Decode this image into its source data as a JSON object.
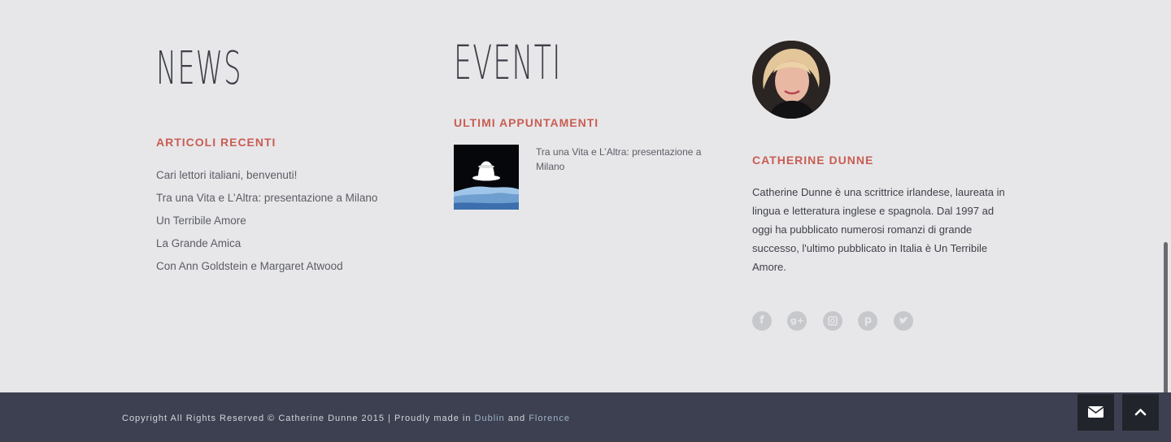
{
  "news": {
    "title": "NEWS",
    "heading": "ARTICOLI RECENTI",
    "articles": [
      "Cari lettori italiani, benvenuti!",
      "Tra una Vita e L’Altra: presentazione a Milano",
      "Un Terribile Amore",
      "La Grande Amica",
      "Con Ann Goldstein e Margaret Atwood"
    ]
  },
  "events": {
    "title": "EVENTI",
    "heading": "ULTIMI APPUNTAMENTI",
    "items": [
      {
        "title": "Tra una Vita e L’Altra: presentazione a Milano",
        "thumb_icon": "bowler-hat-image"
      }
    ]
  },
  "author": {
    "name": "CATHERINE DUNNE",
    "bio": "Catherine Dunne è una scrittrice irlandese, laureata in lingua e letteratura inglese e spagnola. Dal 1997 ad oggi ha pubblicato numerosi romanzi di grande successo, l'ultimo pubblicato in Italia è Un Terribile Amore.",
    "social": [
      "facebook-icon",
      "google-plus-icon",
      "instagram-icon",
      "pinterest-icon",
      "twitter-icon"
    ]
  },
  "footer": {
    "copyright_text": "Copyright All Rights Reserved © Catherine Dunne 2015 | Proudly made in ",
    "link_1": "Dublin",
    "and_text": " and ",
    "link_2": "Florence"
  },
  "colors": {
    "accent": "#c95d52",
    "page_bg": "#e7e7ea",
    "footer_bg": "#3d4050",
    "button_bg": "#22242c"
  }
}
